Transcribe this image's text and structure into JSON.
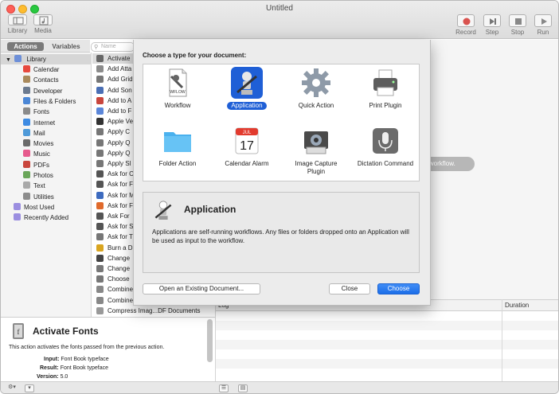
{
  "window": {
    "title": "Untitled"
  },
  "toolbar": {
    "left": [
      {
        "name": "library",
        "label": "Library"
      },
      {
        "name": "media",
        "label": "Media"
      }
    ],
    "right": [
      {
        "name": "record",
        "label": "Record"
      },
      {
        "name": "step",
        "label": "Step"
      },
      {
        "name": "stop",
        "label": "Stop"
      },
      {
        "name": "run",
        "label": "Run"
      }
    ]
  },
  "left_tabs": {
    "actions": "Actions",
    "variables": "Variables"
  },
  "search": {
    "placeholder": "Name",
    "icon": "magnifier-icon"
  },
  "library": {
    "root": "Library",
    "items": [
      "Calendar",
      "Contacts",
      "Developer",
      "Files & Folders",
      "Fonts",
      "Internet",
      "Mail",
      "Movies",
      "Music",
      "PDFs",
      "Photos",
      "Text",
      "Utilities"
    ],
    "smart": [
      "Most Used",
      "Recently Added"
    ]
  },
  "actions": [
    "Activate",
    "Add Atta",
    "Add Grid",
    "Add Son",
    "Add to A",
    "Add to F",
    "Apple Ve",
    "Apply C",
    "Apply Q",
    "Apply Q",
    "Apply Sl",
    "Ask for C",
    "Ask for F",
    "Ask for M",
    "Ask for F",
    "Ask For",
    "Ask for S",
    "Ask for T",
    "Burn a D",
    "Change",
    "Change",
    "Choose",
    "Combine",
    "Combine",
    "Compress Imag...DF Documents"
  ],
  "workflow": {
    "hint": "r workflow."
  },
  "log": {
    "columns": [
      "Log",
      "Duration"
    ]
  },
  "description": {
    "title": "Activate Fonts",
    "text": "This action activates the fonts passed from the previous action.",
    "input_label": "Input:",
    "input_value": "Font Book typeface",
    "result_label": "Result:",
    "result_value": "Font Book typeface",
    "version_label": "Version:",
    "version_value": "5.0"
  },
  "sheet": {
    "heading": "Choose a type for your document:",
    "types": [
      {
        "label": "Workflow",
        "selected": false
      },
      {
        "label": "Application",
        "selected": true
      },
      {
        "label": "Quick Action",
        "selected": false
      },
      {
        "label": "Print Plugin",
        "selected": false
      },
      {
        "label": "Folder Action",
        "selected": false
      },
      {
        "label": "Calendar Alarm",
        "selected": false
      },
      {
        "label": "Image Capture Plugin",
        "selected": false
      },
      {
        "label": "Dictation Command",
        "selected": false
      }
    ],
    "workflow_icon_text": "WFLOW",
    "calendar_icon": {
      "month": "JUL",
      "day": "17"
    },
    "info_title": "Application",
    "info_text": "Applications are self-running workflows. Any files or folders dropped onto an Application will be used as input to the workflow.",
    "buttons": {
      "open": "Open an Existing Document...",
      "close": "Close",
      "choose": "Choose"
    }
  },
  "colors": {
    "accent": "#1f5fd6",
    "selection": "#dcdcdc"
  }
}
